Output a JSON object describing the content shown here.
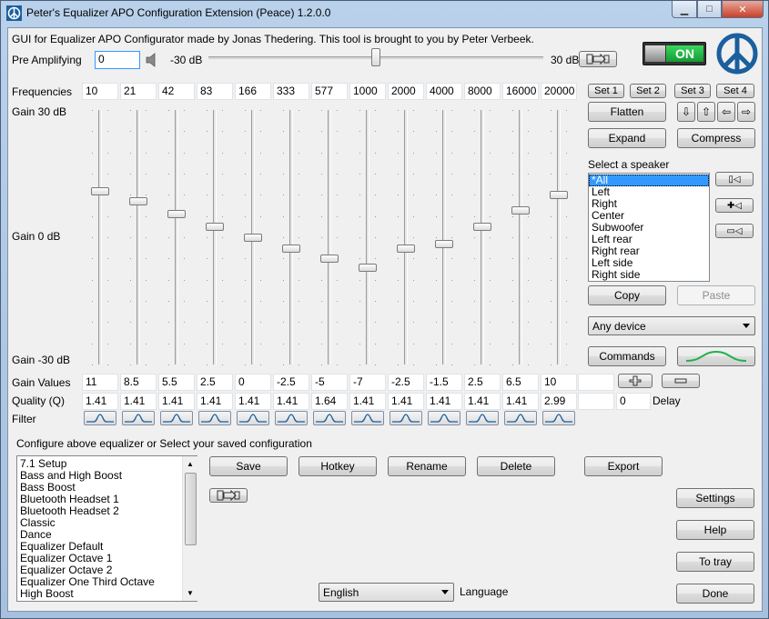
{
  "window": {
    "title": "Peter's Equalizer APO Configuration Extension (Peace) 1.2.0.0"
  },
  "header": {
    "credit": "GUI for Equalizer APO Configurator made by Jonas Thedering. This tool is brought to you by Peter Verbeek."
  },
  "preamp": {
    "label": "Pre Amplifying",
    "value": "0",
    "min_label": "-30 dB",
    "max_label": "30 dB",
    "level_db": 0
  },
  "power": {
    "label": "ON"
  },
  "eq": {
    "freq_label": "Frequencies",
    "gain_top": "Gain 30 dB",
    "gain_mid": "Gain 0 dB",
    "gain_bottom": "Gain -30 dB",
    "gain_values_label": "Gain Values",
    "quality_label": "Quality (Q)",
    "filter_label": "Filter",
    "frequencies": [
      "10",
      "21",
      "42",
      "83",
      "166",
      "333",
      "577",
      "1000",
      "2000",
      "4000",
      "8000",
      "16000",
      "20000"
    ],
    "gains": [
      "11",
      "8.5",
      "5.5",
      "2.5",
      "0",
      "-2.5",
      "-5",
      "-7",
      "-2.5",
      "-1.5",
      "2.5",
      "6.5",
      "10"
    ],
    "qualities": [
      "1.41",
      "1.41",
      "1.41",
      "1.41",
      "1.41",
      "1.41",
      "1.64",
      "1.41",
      "1.41",
      "1.41",
      "1.41",
      "1.41",
      "2.99"
    ],
    "gain_levels": [
      11,
      8.5,
      5.5,
      2.5,
      0,
      -2.5,
      -5,
      -7,
      -2.5,
      -1.5,
      2.5,
      6.5,
      10
    ],
    "delay_value": "0",
    "delay_label": "Delay"
  },
  "sets": [
    "Set 1",
    "Set 2",
    "Set 3",
    "Set 4"
  ],
  "buttons": {
    "flatten": "Flatten",
    "expand": "Expand",
    "compress": "Compress",
    "copy": "Copy",
    "paste": "Paste",
    "commands": "Commands",
    "save": "Save",
    "hotkey": "Hotkey",
    "rename": "Rename",
    "delete": "Delete",
    "export": "Export",
    "settings": "Settings",
    "help": "Help",
    "to_tray": "To tray",
    "done": "Done"
  },
  "speaker": {
    "label": "Select a speaker",
    "items": [
      "*All",
      "Left",
      "Right",
      "Center",
      "Subwoofer",
      "Left rear",
      "Right rear",
      "Left side",
      "Right side"
    ],
    "selected": "*All"
  },
  "device": {
    "selected": "Any device"
  },
  "config": {
    "label": "Configure above equalizer or Select your saved configuration",
    "items": [
      "7.1 Setup",
      "Bass and High Boost",
      "Bass Boost",
      "Bluetooth Headset 1",
      "Bluetooth Headset 2",
      "Classic",
      "Dance",
      "Equalizer Default",
      "Equalizer Octave 1",
      "Equalizer Octave 2",
      "Equalizer One Third Octave",
      "High Boost"
    ]
  },
  "language": {
    "selected": "English",
    "label": "Language"
  },
  "colors": {
    "accent_blue": "#1a5f9e",
    "power_green": "#22b14c",
    "selection": "#3399ff"
  }
}
